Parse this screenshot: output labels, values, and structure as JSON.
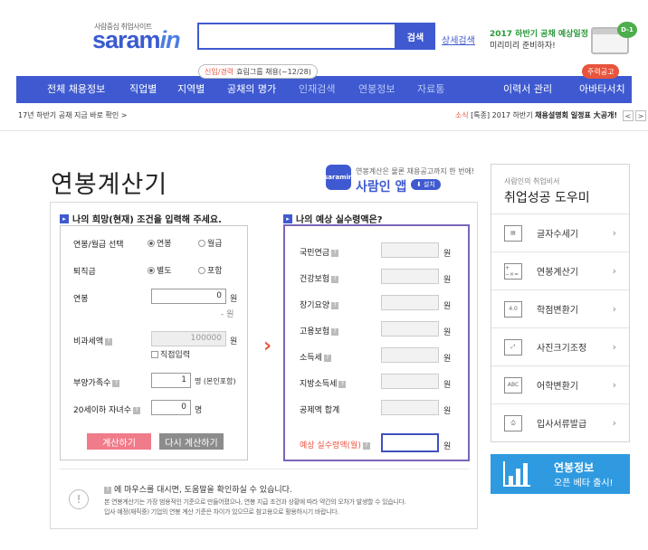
{
  "header": {
    "logo_tagline": "사람중심 취업사이트",
    "logo_text": "saram",
    "logo_text_in": "in",
    "search_button": "검색",
    "advanced_search": "상세검색",
    "promo_line1": "2017 하반기 공채 예상일정",
    "promo_line2": "미리미리 준비하자!",
    "promo_badge": "D-1"
  },
  "nav": {
    "tag_highlight": "신입/경력",
    "tag_text": "효림그룹 채용(~12/28)",
    "hot_badge": "주력공고",
    "items": [
      "전체 채용정보",
      "직업별",
      "지역별",
      "공채의 명가",
      "인재검색",
      "연봉정보",
      "자료통",
      "이력서 관리",
      "아바타서치"
    ]
  },
  "subbar": {
    "left": "17년 하반기 공채 지금 바로 확인 >",
    "right_prefix": "소식",
    "right_keyword": "[특종]",
    "right_text": "2017 하반기 ",
    "right_bold": "채용설명회 일정표 大공개!",
    "prev": "<",
    "next": ">"
  },
  "page": {
    "title": "연봉계산기",
    "app_icon": "saramin",
    "app_caption": "연봉계산은 물론 채용공고까지 한 번에!",
    "app_name": "사람인 앱",
    "app_install": "설치"
  },
  "left_form": {
    "heading": "나의 희망(현재) 조건을 입력해 주세요.",
    "salary_type_label": "연봉/월급 선택",
    "opt_annual": "연봉",
    "opt_monthly": "월급",
    "severance_label": "퇴직금",
    "opt_separate": "별도",
    "opt_included": "포함",
    "annual_label": "연봉",
    "annual_value": "0",
    "annual_unit": "원",
    "annual_hint": "- 원",
    "nontax_label": "비과세액",
    "nontax_value": "100000",
    "nontax_unit": "원",
    "direct_input": "직접입력",
    "dependents_label": "부양가족수",
    "dependents_value": "1",
    "dependents_unit": "명 (본인포함)",
    "children_label": "20세이하 자녀수",
    "children_value": "0",
    "children_unit": "명",
    "calc_button": "계산하기",
    "reset_button": "다시 계산하기"
  },
  "right_form": {
    "heading": "나의 예상 실수령액은?",
    "rows": [
      {
        "label": "국민연금",
        "unit": "원"
      },
      {
        "label": "건강보험",
        "unit": "원"
      },
      {
        "label": "장기요양",
        "unit": "원"
      },
      {
        "label": "고용보험",
        "unit": "원"
      },
      {
        "label": "소득세",
        "unit": "원"
      },
      {
        "label": "지방소득세",
        "unit": "원"
      },
      {
        "label": "공제액 합계",
        "unit": "원"
      }
    ],
    "final_label": "예상 실수령액(월)",
    "final_unit": "원"
  },
  "notes": {
    "line1": "에 마우스를 대시면, 도움말을 확인하실 수 있습니다.",
    "line2": "본 연봉계산기는 가장 범용적인 기준으로 만들어졌으나, 연봉 지급 조건과 상황에 따라 약간의 오차가 발생할 수 있습니다.",
    "line3": "입사 예정(재직중) 기업의 연봉 계산 기준은 차이가 있으므로 참고용으로 활용하시기 바랍니다."
  },
  "sidebar": {
    "sub": "사람인의 취업비서",
    "title": "취업성공 도우미",
    "items": [
      {
        "label": "글자수세기",
        "icon": "doc-count-icon"
      },
      {
        "label": "연봉계산기",
        "icon": "calculator-icon"
      },
      {
        "label": "학점변환기",
        "icon": "grade-icon"
      },
      {
        "label": "사진크기조정",
        "icon": "resize-icon"
      },
      {
        "label": "어학변환기",
        "icon": "abc-icon"
      },
      {
        "label": "입사서류발급",
        "icon": "printer-icon"
      }
    ],
    "banner_title": "연봉정보",
    "banner_sub": "오픈 베타 출시!"
  }
}
